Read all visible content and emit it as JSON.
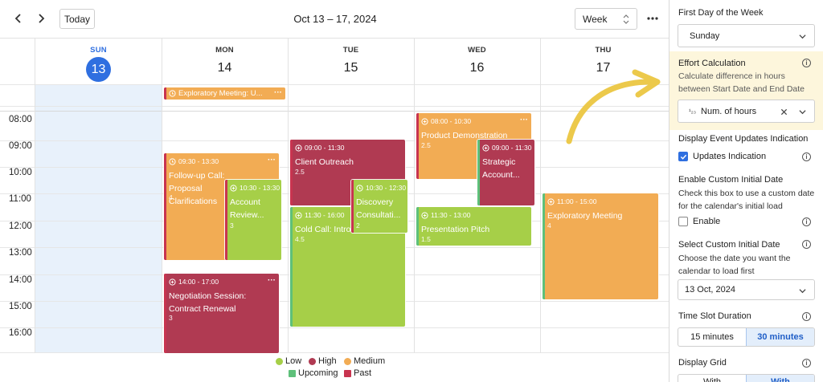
{
  "toolbar": {
    "today_label": "Today",
    "date_range": "Oct 13 – 17, 2024",
    "view_value": "Week"
  },
  "days": [
    {
      "name": "SUN",
      "num": "13",
      "today": true
    },
    {
      "name": "MON",
      "num": "14"
    },
    {
      "name": "TUE",
      "num": "15"
    },
    {
      "name": "WED",
      "num": "16"
    },
    {
      "name": "THU",
      "num": "17"
    }
  ],
  "times": [
    "08:00",
    "09:00",
    "10:00",
    "11:00",
    "12:00",
    "13:00",
    "14:00",
    "15:00",
    "16:00"
  ],
  "events": {
    "allday_mon": {
      "title": "Exploratory Meeting: U..."
    },
    "ev1": {
      "time": "09:30 - 13:30",
      "title": "Follow-up Call: Proposal Clarifications",
      "effort": "4"
    },
    "ev2": {
      "time": "10:30 - 13:30",
      "title": "Account Review...",
      "effort": "3"
    },
    "ev3": {
      "time": "14:00 - 17:00",
      "title": "Negotiation Session: Contract Renewal",
      "effort": "3"
    },
    "ev4": {
      "time": "09:00 - 11:30",
      "title": "Client Outreach",
      "effort": "2.5"
    },
    "ev5": {
      "time": "10:30 - 12:30",
      "title": "Discovery Consultati...",
      "effort": "2"
    },
    "ev6": {
      "time": "11:30 - 16:00",
      "title": "Cold Call: Intro",
      "effort": "4.5"
    },
    "ev7": {
      "time": "08:00 - 10:30",
      "title": "Product Demonstration",
      "effort": "2.5"
    },
    "ev8": {
      "time": "09:00 - 11:30",
      "title": "Strategic Account...",
      "effort": ""
    },
    "ev9": {
      "time": "11:30 - 13:00",
      "title": "Presentation Pitch",
      "effort": "1.5"
    },
    "ev10": {
      "time": "11:00 - 15:00",
      "title": "Exploratory Meeting",
      "effort": "4"
    }
  },
  "legend": {
    "low": "Low",
    "high": "High",
    "medium": "Medium",
    "upcoming": "Upcoming",
    "past": "Past"
  },
  "colors": {
    "low": "#a6cf48",
    "high": "#b03a52",
    "medium": "#f2ac54",
    "upcoming": "#5ec07a",
    "past": "#c8344f",
    "accent": "#2f6fe0",
    "highlight_arrow": "#ecc94b"
  },
  "panel": {
    "first_day_label": "First Day of the Week",
    "first_day_value": "Sunday",
    "effort_label": "Effort Calculation",
    "effort_desc": "Calculate difference in hours between Start Date and End Date",
    "effort_value": "Num. of hours",
    "effort_prefix": "¹₂₃",
    "updates_label": "Display Event Updates Indication",
    "updates_cb_label": "Updates Indication",
    "custom_date_label": "Enable Custom Initial Date",
    "custom_date_desc": "Check this box to use a custom date for the calendar's initial load",
    "enable_label": "Enable",
    "select_date_label": "Select Custom Initial Date",
    "select_date_desc": "Choose the date you want the calendar to load first",
    "date_value": "13 Oct, 2024",
    "slot_label": "Time Slot Duration",
    "slot_opt1": "15 minutes",
    "slot_opt2": "30 minutes",
    "grid_label": "Display Grid",
    "grid_opt1": "With",
    "grid_opt2": "With"
  }
}
